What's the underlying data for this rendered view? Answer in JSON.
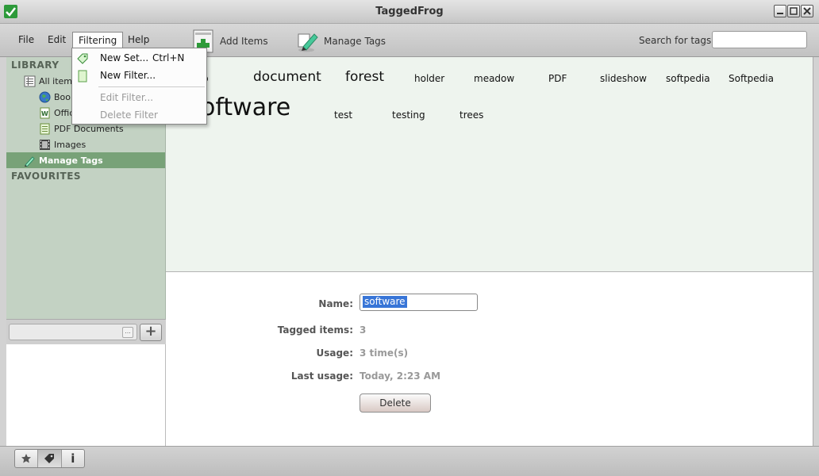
{
  "window": {
    "title": "TaggedFrog"
  },
  "menu": {
    "file": "File",
    "edit": "Edit",
    "filtering": "Filtering",
    "help": "Help"
  },
  "toolbar": {
    "add_items": "Add Items",
    "manage_tags": "Manage Tags",
    "search_label": "Search for tags",
    "search_value": ""
  },
  "filtering_menu": {
    "new_set": "New Set...",
    "new_set_shortcut": "Ctrl+N",
    "new_filter": "New Filter...",
    "edit_filter": "Edit Filter...",
    "delete_filter": "Delete Filter"
  },
  "sidebar": {
    "library_label": "LIBRARY",
    "items": [
      {
        "label": "All items",
        "icon": "list-icon"
      },
      {
        "label": "Book",
        "icon": "globe-icon"
      },
      {
        "label": "Offic",
        "icon": "word-doc-icon"
      },
      {
        "label": "PDF Documents",
        "icon": "document-icon"
      },
      {
        "label": "Images",
        "icon": "film-icon"
      }
    ],
    "manage_tags": "Manage Tags",
    "favourites_label": "FAVOURITES"
  },
  "tags": [
    {
      "label": "p"
    },
    {
      "label": "document"
    },
    {
      "label": "forest"
    },
    {
      "label": "holder"
    },
    {
      "label": "meadow"
    },
    {
      "label": "PDF"
    },
    {
      "label": "slideshow"
    },
    {
      "label": "softpedia"
    },
    {
      "label": "Softpedia"
    },
    {
      "label": "oftware"
    },
    {
      "label": "test"
    },
    {
      "label": "testing"
    },
    {
      "label": "trees"
    }
  ],
  "details": {
    "name_label": "Name:",
    "name_value": "software",
    "tagged_items_label": "Tagged items:",
    "tagged_items_value": "3",
    "usage_label": "Usage:",
    "usage_value": "3 time(s)",
    "last_usage_label": "Last usage:",
    "last_usage_value": "Today, 2:23 AM",
    "delete_label": "Delete"
  },
  "bottombar": {
    "info_label": "i"
  },
  "colors": {
    "sidebar_bg": "#c3d2c3",
    "selected_bg": "#78a278",
    "tagcloud_bg": "#eef4ee"
  }
}
